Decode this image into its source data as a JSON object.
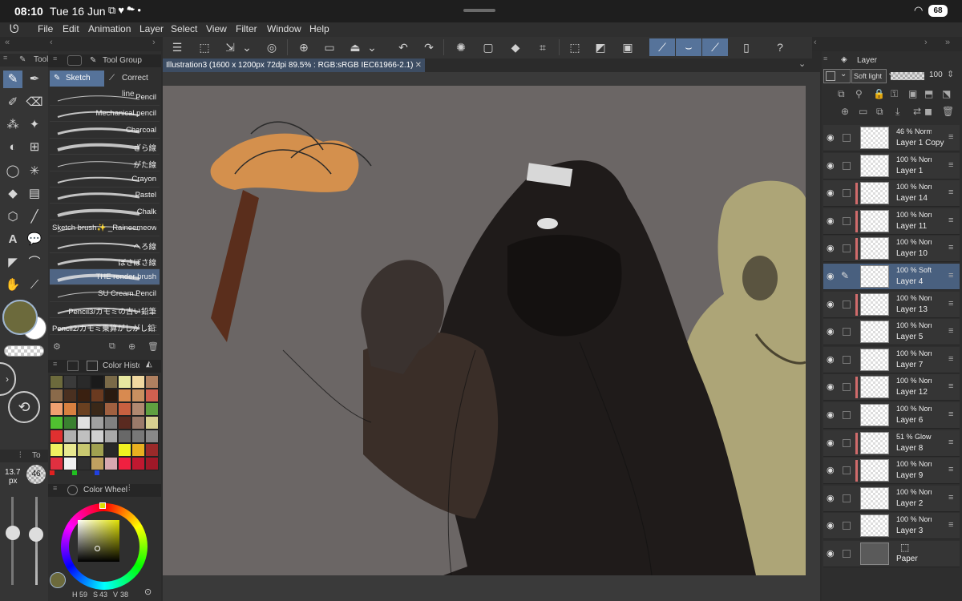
{
  "status_bar": {
    "time": "08:10",
    "date": "Tue 16 Jun",
    "battery": "68"
  },
  "menu": [
    "File",
    "Edit",
    "Animation",
    "Layer",
    "Select",
    "View",
    "Filter",
    "Window",
    "Help"
  ],
  "tool_panel": {
    "tab": "Tool",
    "brush_size": "13.7",
    "brush_unit": "px",
    "opacity": "46"
  },
  "sub_tool_panel": {
    "title": "Tool Group",
    "tabs": [
      "Sketch",
      "Correct line"
    ],
    "brushes": [
      "Pencil",
      "Mechanical pencil",
      "Charcoal",
      "ざら線",
      "がた線",
      "Crayon",
      "Pastel",
      "Chalk",
      "Sketch brush✨ _Raineemeow",
      "へろ線",
      "ぼさぼさ線",
      "THE render brush",
      "SU Cream Pencil",
      "Pencil3/カモミの古い鉛筆",
      "Pencil2/カモミ乗算がしがし鉛筆"
    ],
    "selected_brush": "THE render brush"
  },
  "color_history": {
    "title": "Color History",
    "colors": [
      "#6c6a3c",
      "#3a3a3a",
      "#2a2a2a",
      "#1a1a1a",
      "#7a6a48",
      "#e8e8a0",
      "#f0d8a0",
      "#b08060",
      "#8a6a4a",
      "#4a3020",
      "#3a2010",
      "#6a3a20",
      "#2a1a10",
      "#d88a50",
      "#c89060",
      "#d06050",
      "#f0a070",
      "#d88040",
      "#6a4020",
      "#3a2818",
      "#a06040",
      "#c86040",
      "#b08870",
      "#60a040",
      "#50c030",
      "#3a8030",
      "#e0e0e0",
      "#a0a0a0",
      "#808080",
      "#5a2a20",
      "#9a7a6a",
      "#d8d090",
      "#e03030",
      "#b0b0b0",
      "#c0c0c0",
      "#d0d0d0",
      "#a8a8a8",
      "#686868",
      "#787878",
      "#888888",
      "#f0f060",
      "#e8e890",
      "#c8c870",
      "#a0a050",
      "#282828",
      "#f0f020",
      "#e8b020",
      "#9a2a2a",
      "#e03040",
      "#f0f0f0",
      "#303030",
      "#c0a060",
      "#d8a8b0",
      "#f02040",
      "#c01830",
      "#a01828"
    ]
  },
  "color_wheel": {
    "title": "Color Wheel",
    "h": "59",
    "s": "43",
    "v": "38"
  },
  "document": {
    "title": "Illustration3 (1600 x 1200px 72dpi 89.5% : RGB:sRGB IEC61966-2.1)"
  },
  "layer_panel": {
    "title": "Layer",
    "blend_mode": "Soft light",
    "opacity": "100",
    "layers": [
      {
        "blend": "46 % Normal",
        "name": "Layer 1 Copy",
        "marked": false,
        "selected": false
      },
      {
        "blend": "100 % Normal",
        "name": "Layer 1",
        "marked": false,
        "selected": false
      },
      {
        "blend": "100 % Normal",
        "name": "Layer 14",
        "marked": true,
        "selected": false
      },
      {
        "blend": "100 % Normal",
        "name": "Layer 11",
        "marked": true,
        "selected": false
      },
      {
        "blend": "100 % Normal",
        "name": "Layer 10",
        "marked": true,
        "selected": false
      },
      {
        "blend": "100 % Soft light",
        "name": "Layer 4",
        "marked": false,
        "selected": true
      },
      {
        "blend": "100 % Normal",
        "name": "Layer 13",
        "marked": true,
        "selected": false
      },
      {
        "blend": "100 % Normal",
        "name": "Layer 5",
        "marked": false,
        "selected": false
      },
      {
        "blend": "100 % Normal",
        "name": "Layer 7",
        "marked": false,
        "selected": false
      },
      {
        "blend": "100 % Normal",
        "name": "Layer 12",
        "marked": true,
        "selected": false
      },
      {
        "blend": "100 % Normal",
        "name": "Layer 6",
        "marked": false,
        "selected": false
      },
      {
        "blend": "51 % Glow dodge",
        "name": "Layer 8",
        "marked": true,
        "selected": false
      },
      {
        "blend": "100 % Normal",
        "name": "Layer 9",
        "marked": true,
        "selected": false
      },
      {
        "blend": "100 % Normal",
        "name": "Layer 2",
        "marked": false,
        "selected": false
      },
      {
        "blend": "100 % Normal",
        "name": "Layer 3",
        "marked": false,
        "selected": false
      },
      {
        "blend": "",
        "name": "Paper",
        "marked": false,
        "selected": false
      }
    ]
  },
  "accent_color": "#56739a"
}
